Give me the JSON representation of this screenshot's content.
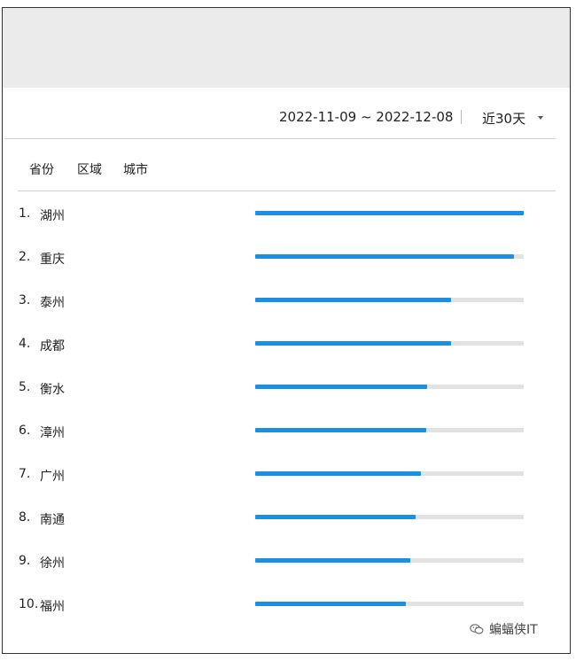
{
  "header": {
    "date_range": "2022-11-09 ~ 2022-12-08",
    "period": "近30天"
  },
  "tabs": [
    "省份",
    "区域",
    "城市"
  ],
  "ranking": [
    {
      "rank": "1.",
      "city": "湖州",
      "value": 1.0
    },
    {
      "rank": "2.",
      "city": "重庆",
      "value": 0.963
    },
    {
      "rank": "3.",
      "city": "泰州",
      "value": 0.729
    },
    {
      "rank": "4.",
      "city": "成都",
      "value": 0.729
    },
    {
      "rank": "5.",
      "city": "衡水",
      "value": 0.64
    },
    {
      "rank": "6.",
      "city": "漳州",
      "value": 0.637
    },
    {
      "rank": "7.",
      "city": "广州",
      "value": 0.617
    },
    {
      "rank": "8.",
      "city": "南通",
      "value": 0.597
    },
    {
      "rank": "9.",
      "city": "徐州",
      "value": 0.577
    },
    {
      "rank": "10.",
      "city": "福州",
      "value": 0.561
    }
  ],
  "colors": {
    "bar_fill": "#1a8fe3",
    "bar_track": "#e2e2e2",
    "top_band": "#ebebeb"
  },
  "watermark": {
    "text": "蝙蝠侠IT",
    "icon": "wechat-icon"
  }
}
